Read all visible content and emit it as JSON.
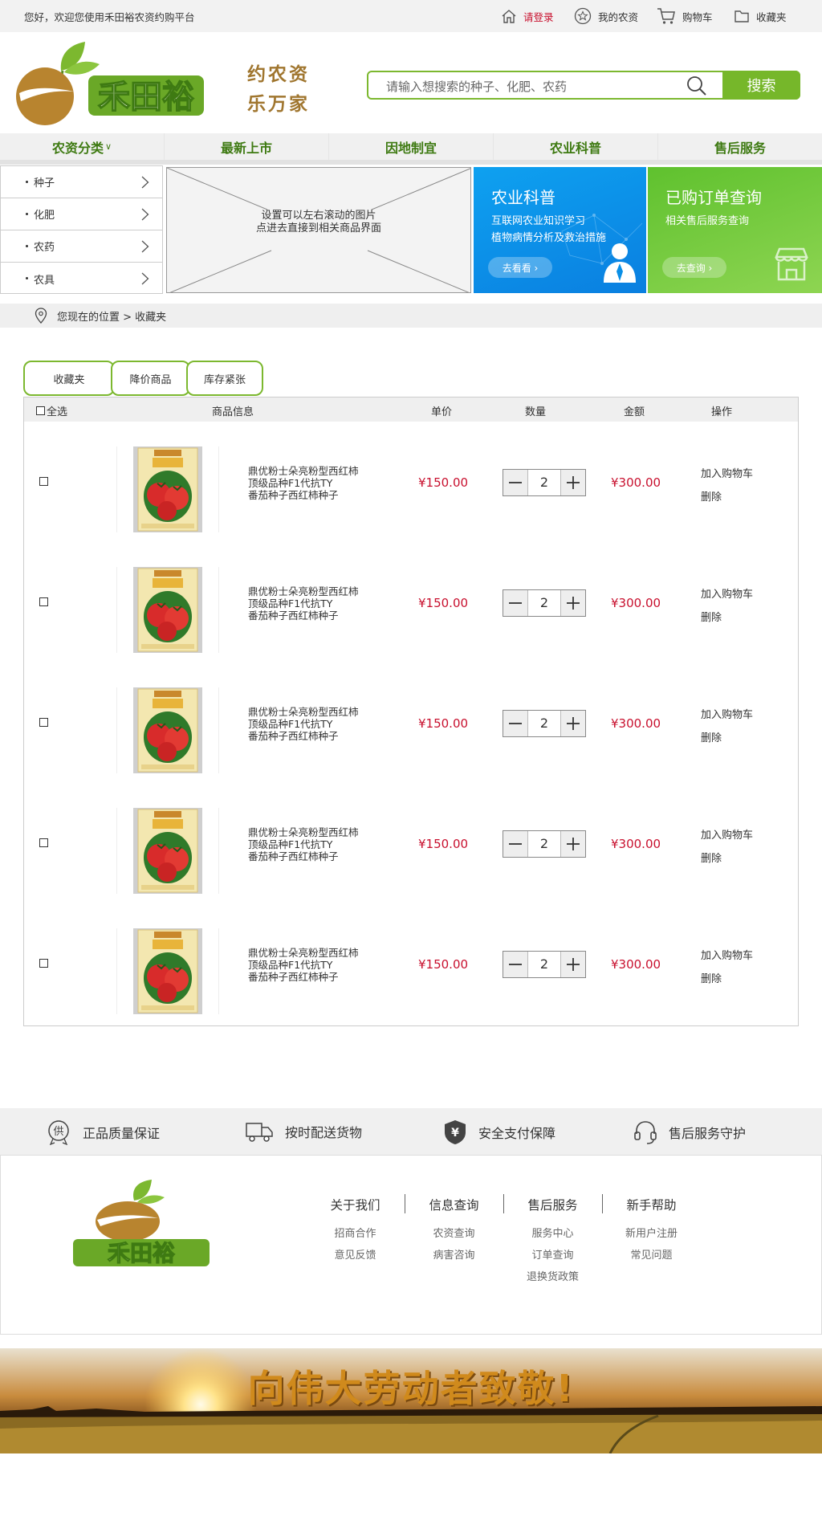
{
  "topbar": {
    "welcome": "您好，欢迎您使用禾田裕农资约购平台",
    "links": {
      "login": "请登录",
      "my_shop": "我的农资",
      "cart": "购物车",
      "favorites": "收藏夹"
    }
  },
  "header": {
    "logo_text": "禾田裕",
    "slogan_line1": "约农资",
    "slogan_line2": "乐万家",
    "search_placeholder": "请输入想搜索的种子、化肥、农药",
    "search_button": "搜索",
    "brand_green": "#76b72a",
    "brand_brown": "#b8842f",
    "accent_red": "#c8102e"
  },
  "nav": {
    "items": [
      "农资分类",
      "最新上市",
      "因地制宜",
      "农业科普",
      "售后服务"
    ],
    "dropdown_mark": "∨"
  },
  "categories": [
    "种子",
    "化肥",
    "农药",
    "农具"
  ],
  "banner": {
    "line1": "设置可以左右滚动的图片",
    "line2": "点进去直接到相关商品界面"
  },
  "cards": {
    "science": {
      "title": "农业科普",
      "line1": "互联网农业知识学习",
      "line2": "植物病情分析及救治措施",
      "button": "去看看 ›"
    },
    "orders": {
      "title": "已购订单查询",
      "line1": "相关售后服务查询",
      "button": "去查询 ›"
    }
  },
  "breadcrumb": "您现在的位置 > 收藏夹",
  "tabs": [
    "收藏夹",
    "降价商品",
    "库存紧张"
  ],
  "table": {
    "headers": {
      "select_all": "全选",
      "info": "商品信息",
      "unit_price": "单价",
      "quantity": "数量",
      "amount": "金额",
      "operation": "操作"
    },
    "rows": [
      {
        "name1": "鼎优粉士朵亮粉型西红柿",
        "name2": "顶级品种F1代抗TY",
        "name3": "番茄种子西红柿种子",
        "price": "¥150.00",
        "qty": "2",
        "amount": "¥300.00",
        "add_cart": "加入购物车",
        "delete": "删除",
        "checked": false
      },
      {
        "name1": "鼎优粉士朵亮粉型西红柿",
        "name2": "顶级品种F1代抗TY",
        "name3": "番茄种子西红柿种子",
        "price": "¥150.00",
        "qty": "2",
        "amount": "¥300.00",
        "add_cart": "加入购物车",
        "delete": "删除",
        "checked": false
      },
      {
        "name1": "鼎优粉士朵亮粉型西红柿",
        "name2": "顶级品种F1代抗TY",
        "name3": "番茄种子西红柿种子",
        "price": "¥150.00",
        "qty": "2",
        "amount": "¥300.00",
        "add_cart": "加入购物车",
        "delete": "删除",
        "checked": false
      },
      {
        "name1": "鼎优粉士朵亮粉型西红柿",
        "name2": "顶级品种F1代抗TY",
        "name3": "番茄种子西红柿种子",
        "price": "¥150.00",
        "qty": "2",
        "amount": "¥300.00",
        "add_cart": "加入购物车",
        "delete": "删除",
        "checked": false
      },
      {
        "name1": "鼎优粉士朵亮粉型西红柿",
        "name2": "顶级品种F1代抗TY",
        "name3": "番茄种子西红柿种子",
        "price": "¥150.00",
        "qty": "2",
        "amount": "¥300.00",
        "add_cart": "加入购物车",
        "delete": "删除",
        "checked": false
      }
    ]
  },
  "services": [
    "正品质量保证",
    "按时配送货物",
    "安全支付保障",
    "售后服务守护"
  ],
  "service_icon_glyphs": {
    "quality": "供",
    "payment": "¥"
  },
  "footer": {
    "logo_text": "禾田裕",
    "columns": [
      {
        "head": "关于我们",
        "links": [
          "招商合作",
          "意见反馈"
        ]
      },
      {
        "head": "信息查询",
        "links": [
          "农资查询",
          "病害咨询"
        ]
      },
      {
        "head": "售后服务",
        "links": [
          "服务中心",
          "订单查询",
          "退换货政策"
        ]
      },
      {
        "head": "新手帮助",
        "links": [
          "新用户注册",
          "常见问题"
        ]
      }
    ]
  },
  "bottom_banner": "向伟大劳动者致敬!"
}
